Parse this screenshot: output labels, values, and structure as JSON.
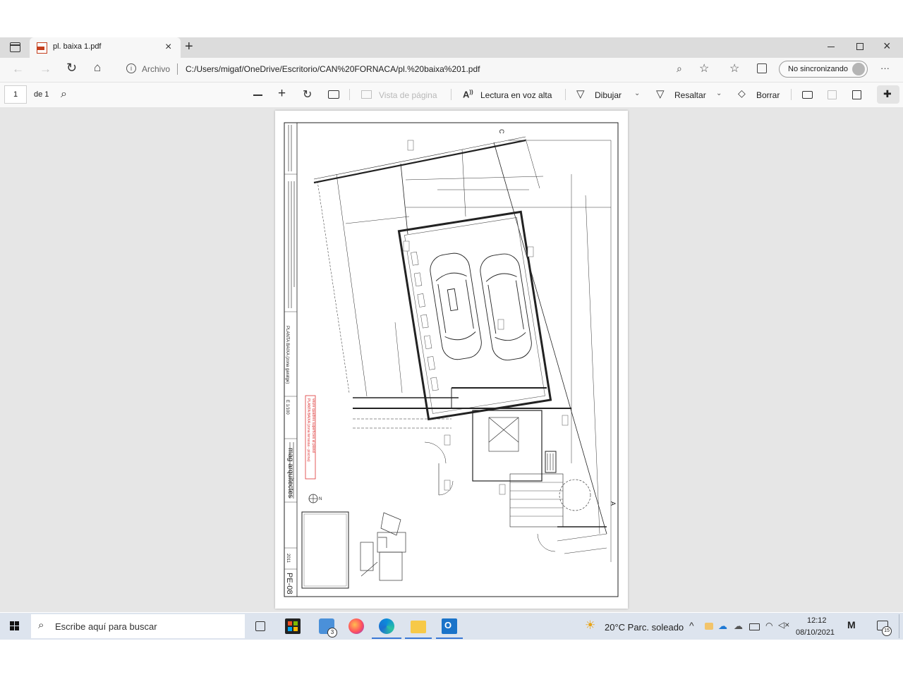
{
  "browser": {
    "tab_title": "pl. baixa 1.pdf",
    "address_label": "Archivo",
    "url": "C:/Users/migaf/OneDrive/Escritorio/CAN%20FORNACA/pl.%20baixa%201.pdf",
    "sync_label": "No sincronizando",
    "more_label": "···"
  },
  "pdf_toolbar": {
    "page_number": "1",
    "page_total": "de 1",
    "page_view_label": "Vista de página",
    "read_aloud_label": "Lectura en voz alta",
    "draw_label": "Dibujar",
    "highlight_label": "Resaltar",
    "erase_label": "Borrar"
  },
  "drawing": {
    "sheet_code": "PE-08",
    "firm": "mag arquitectes",
    "plan_title": "PLANTA BAIXA (zona garatge)",
    "scale": "E 1/100",
    "year": "2011",
    "note_line1": "PLANTA BAIXA (zona terrassa - piscina)",
    "note_line2": "veure quadres superficies al plànol",
    "section_c": "C",
    "section_a": "A",
    "north": "N"
  },
  "taskbar": {
    "search_placeholder": "Escribe aquí para buscar",
    "weather": "20°C  Parc. soleado",
    "time": "12:12",
    "date": "08/10/2021",
    "notification_count": "15",
    "badge_count": "3"
  },
  "colors": {
    "accent": "#3b79d6",
    "pdf_red": "#c43e1c",
    "viewer_bg": "#e6e6e6",
    "taskbar_bg": "#dde4ee",
    "tabbar_bg": "#dcdcdc"
  }
}
